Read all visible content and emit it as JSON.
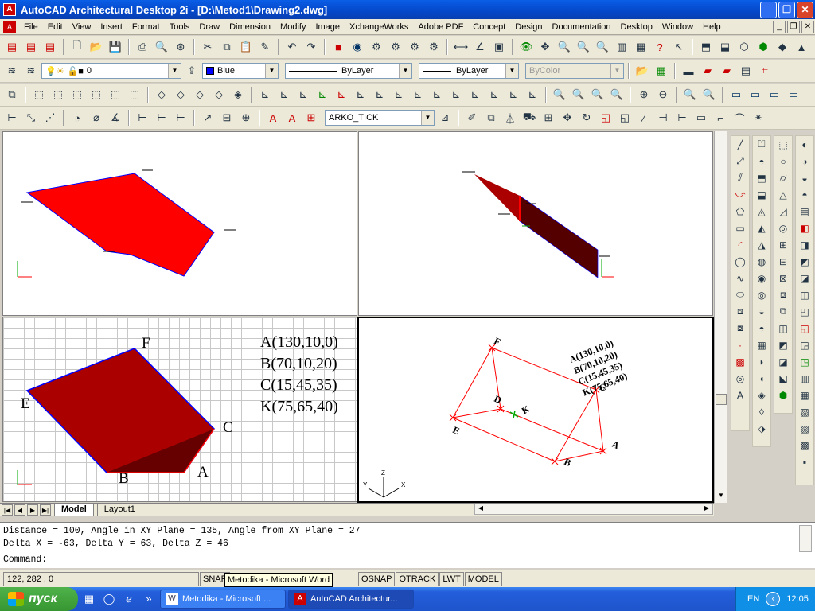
{
  "window": {
    "title": "AutoCAD Architectural Desktop 2i - [D:\\Metod1\\Drawing2.dwg]"
  },
  "menubar": {
    "items": [
      "File",
      "Edit",
      "View",
      "Insert",
      "Format",
      "Tools",
      "Draw",
      "Dimension",
      "Modify",
      "Image",
      "XchangeWorks",
      "Adobe PDF",
      "Concept",
      "Design",
      "Documentation",
      "Desktop",
      "Window",
      "Help"
    ]
  },
  "props": {
    "layer": "0",
    "color": "Blue",
    "linetype": "ByLayer",
    "lineweight": "ByLayer",
    "plotstyle": "ByColor",
    "dimstyle": "ARKO_TICK"
  },
  "viewport_bottom_left": {
    "labels": [
      "E",
      "F",
      "C",
      "A",
      "B"
    ],
    "coords": [
      "A(130,10,0)",
      "B(70,10,20)",
      "C(15,45,35)",
      "K(75,65,40)"
    ]
  },
  "viewport_bottom_right": {
    "labels": [
      "F",
      "D",
      "K",
      "E",
      "B",
      "A",
      "C"
    ],
    "coords": [
      "A(130,10,0)",
      "B(70,10,20)",
      "C(15,45,35)",
      "K(75,65,40)"
    ],
    "axes": [
      "Y",
      "Z",
      "X"
    ]
  },
  "tabs": [
    "Model",
    "Layout1"
  ],
  "command": {
    "line1": "Distance = 100,  Angle in XY Plane = 135,  Angle from XY Plane = 27",
    "line2": "Delta X = -63,  Delta Y = 63,   Delta Z = 46",
    "prompt": "Command:"
  },
  "status": {
    "coords": "122, 282 , 0",
    "buttons": [
      "SNAP",
      "OSNAP",
      "OTRACK",
      "LWT",
      "MODEL"
    ],
    "tooltip": "Metodika - Microsoft Word"
  },
  "taskbar": {
    "start": "пуск",
    "tasks": [
      "Metodika - Microsoft ...",
      "AutoCAD Architectur..."
    ],
    "lang": "EN",
    "clock": "12:05"
  },
  "colors": {
    "face": "#ff0000",
    "face_dark": "#aa0000",
    "edge": "#0000ff"
  }
}
